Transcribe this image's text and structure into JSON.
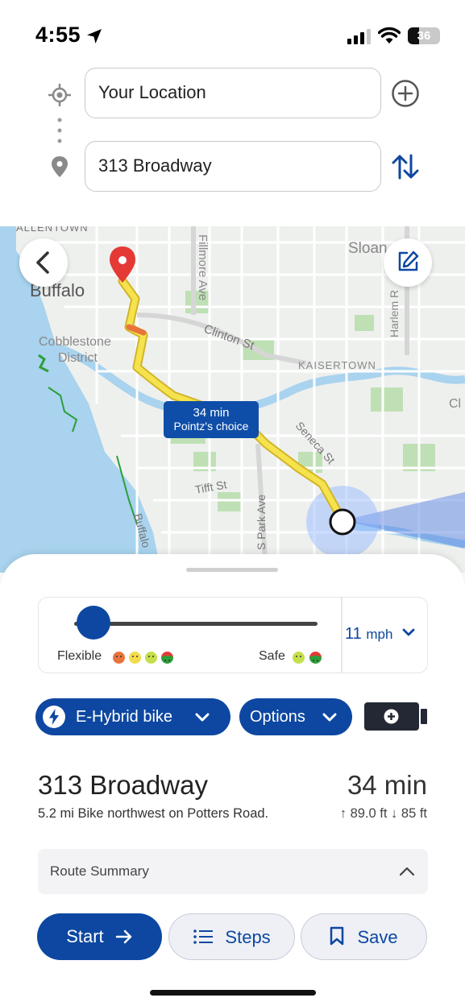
{
  "status_bar": {
    "time": "4:55",
    "battery": "36",
    "battery_fraction": 0.36
  },
  "search": {
    "origin": "Your Location",
    "destination": "313 Broadway",
    "icons": {
      "origin": "crosshair-icon",
      "destination": "location-pin-icon",
      "add": "plus-circle-icon",
      "swap": "swap-vertical-icon"
    }
  },
  "map": {
    "labels": [
      "ALLENTOWN",
      "Buffalo",
      "Cobblestone",
      "District",
      "Fillmore Ave",
      "Sloan",
      "Harlem R",
      "Clinton St",
      "KAISERTOWN",
      "Seneca St",
      "Tifft St",
      "S Park Ave",
      "Buffalo",
      "Cl"
    ],
    "route_callout": {
      "duration": "34 min",
      "subtitle": "Pointz's choice"
    },
    "icons": {
      "back": "chevron-left-icon",
      "edit": "edit-icon"
    }
  },
  "preferences": {
    "slider_left_label": "Flexible",
    "slider_right_label": "Safe",
    "slider_value": 0.08,
    "speed_value": "11",
    "speed_unit": "mph"
  },
  "options": {
    "vehicle": "E-Hybrid bike",
    "options_label": "Options",
    "icons": {
      "vehicle": "lightning-bolt-icon",
      "dropdown": "chevron-down-icon",
      "battery": "battery-plus-icon"
    }
  },
  "route": {
    "destination": "313 Broadway",
    "duration": "34 min",
    "description": "5.2 mi Bike northwest on Potters Road.",
    "elevation_up": "89.0 ft",
    "elevation_down": "85 ft"
  },
  "summary": {
    "label": "Route Summary"
  },
  "actions": {
    "start": "Start",
    "steps": "Steps",
    "save": "Save"
  },
  "colors": {
    "accent": "#0d47a1",
    "route": "#f5e34d",
    "route_congested": "#e8743b",
    "pin": "#e53935"
  }
}
